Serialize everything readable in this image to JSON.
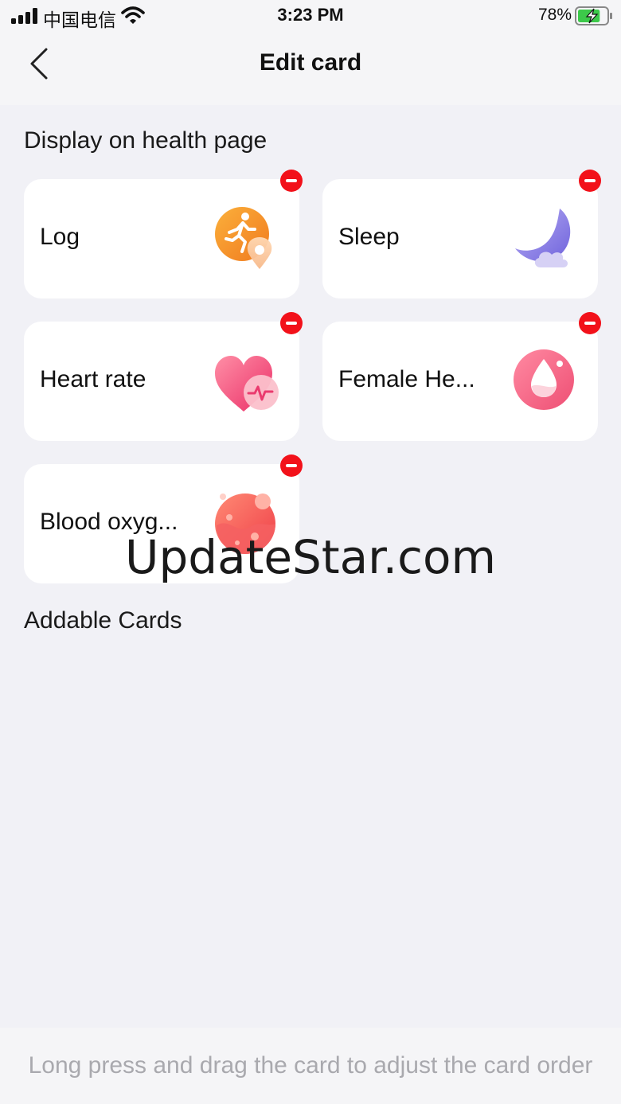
{
  "status_bar": {
    "carrier": "中国电信",
    "time": "3:23 PM",
    "battery_percent": "78%",
    "battery_level": 0.78
  },
  "header": {
    "title": "Edit card",
    "back_icon": "chevron-left-icon"
  },
  "sections": {
    "displayed_title": "Display on health page",
    "addable_title": "Addable Cards"
  },
  "cards": [
    {
      "label": "Log",
      "icon": "running-person-icon"
    },
    {
      "label": "Sleep",
      "icon": "moon-cloud-icon"
    },
    {
      "label": "Heart rate",
      "icon": "heart-pulse-icon"
    },
    {
      "label": "Female He...",
      "icon": "water-drop-icon"
    },
    {
      "label": "Blood oxyg...",
      "icon": "blood-cell-icon"
    }
  ],
  "watermark": "UpdateStar.com",
  "footer": {
    "hint": "Long press and drag the card to adjust the card order"
  },
  "colors": {
    "background": "#f1f1f6",
    "remove_red": "#f2111a",
    "log_orange": "#f5922e",
    "sleep_purple": "#8f86e8",
    "heart_pink": "#f24e7c",
    "female_pink": "#f06083",
    "oxygen_red": "#f25a52"
  }
}
